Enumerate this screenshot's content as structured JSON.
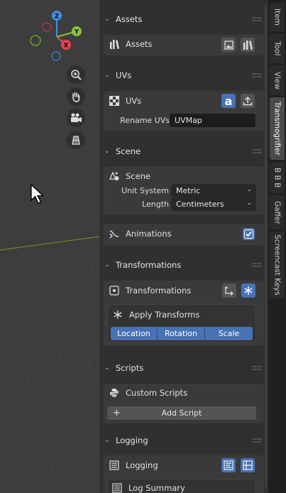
{
  "sidebar": {
    "assets": {
      "header": "Assets",
      "row_label": "Assets"
    },
    "uvs": {
      "header": "UVs",
      "row_label": "UVs",
      "rename_label": "Rename UVs",
      "rename_value": "UVMap"
    },
    "scene": {
      "header": "Scene",
      "row_label": "Scene",
      "unit_system_label": "Unit System",
      "unit_system_value": "Metric",
      "length_label": "Length",
      "length_value": "Centimeters"
    },
    "animations": {
      "label": "Animations",
      "checked": true
    },
    "transformations": {
      "header": "Transformations",
      "row_label": "Transformations",
      "apply_label": "Apply Transforms",
      "buttons": [
        "Location",
        "Rotation",
        "Scale"
      ]
    },
    "scripts": {
      "header": "Scripts",
      "row_label": "Custom Scripts",
      "add_label": "Add Script"
    },
    "logging": {
      "header": "Logging",
      "row_label": "Logging",
      "summary_label": "Log Summary"
    }
  },
  "tabs": [
    "Item",
    "Tool",
    "View",
    "Transmogrifier",
    "B B B",
    "Gaffer",
    "Screencast Keys"
  ],
  "active_tab": "Transmogrifier",
  "gizmo": {
    "x": "X",
    "y": "Y",
    "z": "Z"
  },
  "colors": {
    "accent": "#4772b3",
    "axis_x": "#e8434f",
    "axis_y": "#8ac33c",
    "axis_z": "#3f8fe0"
  }
}
